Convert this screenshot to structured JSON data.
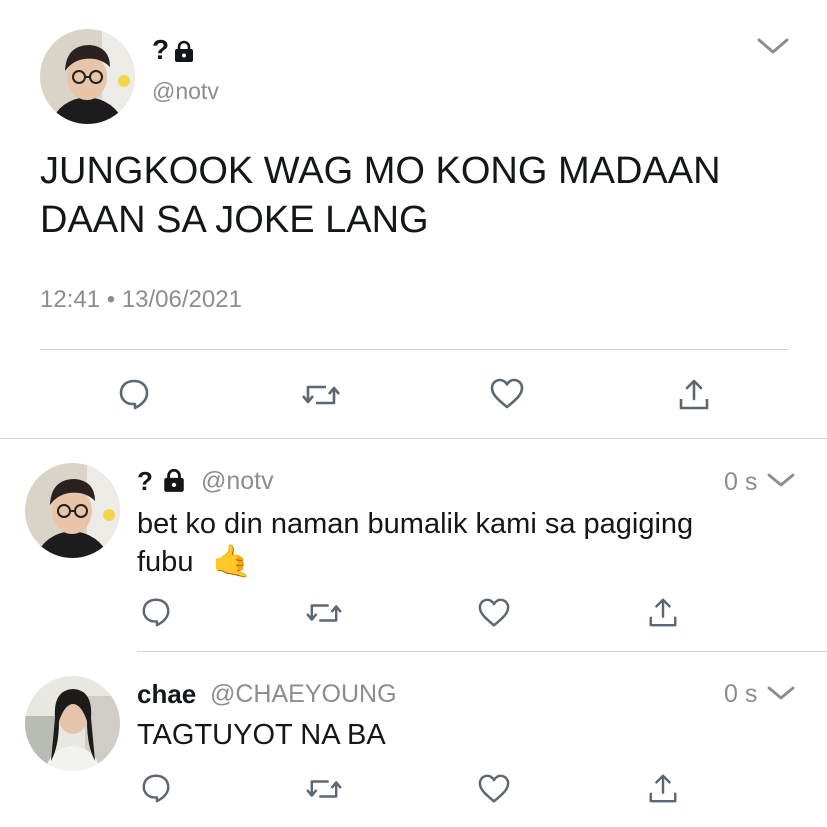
{
  "main_tweet": {
    "display_name": "?",
    "lock_icon": "lock-icon",
    "handle": "@notv",
    "text_line1": "JUNGKOOK WAG MO KONG MADAAN",
    "text_line2": "DAAN SA JOKE LANG",
    "timestamp": "12:41 • 13/06/2021"
  },
  "replies": [
    {
      "display_name": "?",
      "lock_icon": "lock-icon",
      "handle": "@notv",
      "time": "0 s",
      "text_line1": "bet ko din naman bumalik kami sa pagiging",
      "text_line2": "fubu",
      "emoji": "🤙"
    },
    {
      "display_name": "chae",
      "handle": "@CHAEYOUNG",
      "time": "0 s",
      "text_line1": "TAGTUYOT NA BA"
    }
  ],
  "colors": {
    "text": "#14171a",
    "muted": "#8a8d91",
    "divider": "#cfd3d7",
    "icon": "#5b6874"
  }
}
